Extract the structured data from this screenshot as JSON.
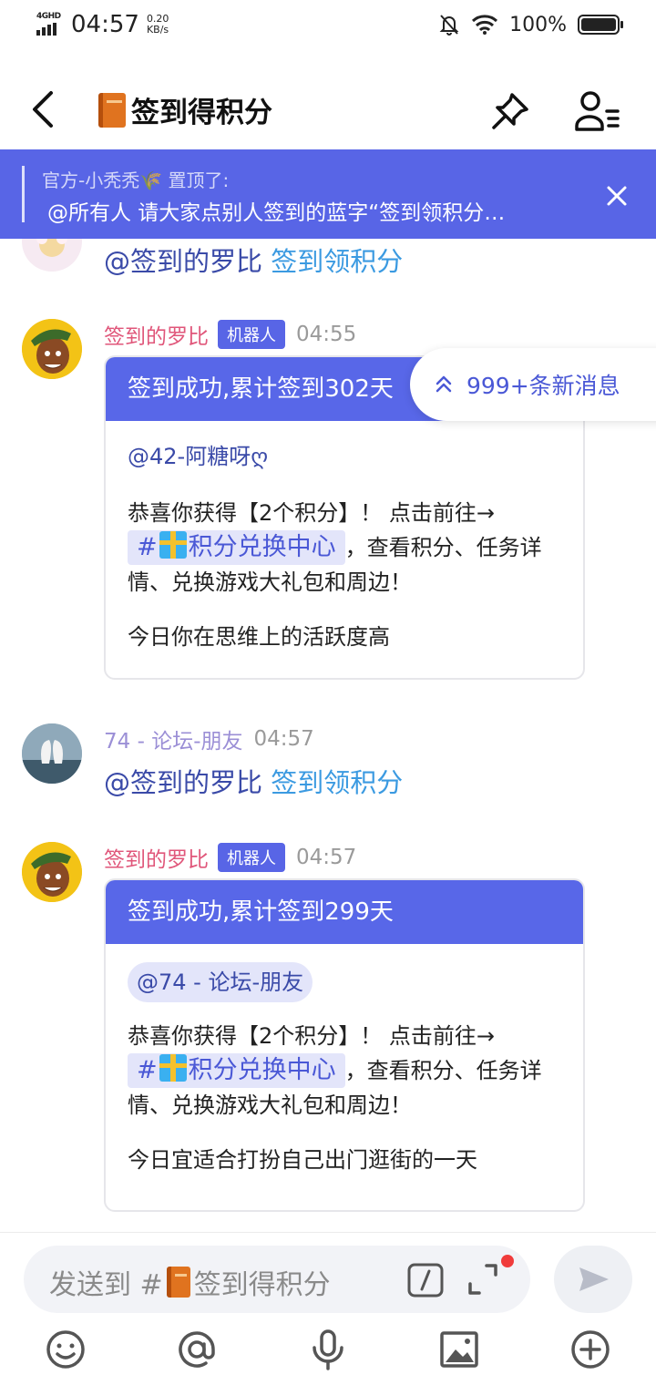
{
  "status_bar": {
    "network": "4GHD",
    "time": "04:57",
    "speed_value": "0.20",
    "speed_unit": "KB/s",
    "battery": "100%"
  },
  "header": {
    "title": "签到得积分"
  },
  "pinned": {
    "author_line": "官方-小秃秃🌾 置顶了:",
    "message": "@所有人 请大家点别人签到的蓝字“签到领积分…"
  },
  "messages": [
    {
      "type": "text",
      "mention": "@签到的罗比",
      "link": "签到领积分"
    },
    {
      "type": "bot_card",
      "sender": "签到的罗比",
      "badge": "机器人",
      "time": "04:55",
      "card_title": "签到成功,累计签到302天",
      "at_user": "@42-阿糖呀ღ",
      "body_pre": "恭喜你获得【2个积分】！ 点击前往→",
      "hash_prefix": "#",
      "hash_label": "积分兑换中心",
      "body_post": "，查看积分、任务详情、兑换游戏大礼包和周边！",
      "fortune": "今日你在思维上的活跃度高"
    },
    {
      "type": "text",
      "sender": "74 - 论坛-朋友",
      "time": "04:57",
      "mention": "@签到的罗比",
      "link": "签到领积分"
    },
    {
      "type": "bot_card",
      "sender": "签到的罗比",
      "badge": "机器人",
      "time": "04:57",
      "card_title": "签到成功,累计签到299天",
      "at_user": "@74 - 论坛-朋友",
      "body_pre": "恭喜你获得【2个积分】！ 点击前往→",
      "hash_prefix": "#",
      "hash_label": "积分兑换中心",
      "body_post": "，查看积分、任务详情、兑换游戏大礼包和周边！",
      "fortune": "今日宜适合打扮自己出门逛街的一天"
    }
  ],
  "new_messages_pill": "999+条新消息",
  "composer": {
    "placeholder_prefix": "发送到 #",
    "placeholder_channel": "签到得积分"
  },
  "colors": {
    "accent": "#5865e6",
    "bot_name": "#e0567a",
    "user_name": "#9b8fd6",
    "link": "#3b9ae1"
  },
  "icons": [
    "back-arrow-icon",
    "book-icon",
    "pin-icon",
    "member-list-icon",
    "close-icon",
    "double-chevron-up-icon",
    "slash-command-icon",
    "expand-icon",
    "send-icon",
    "emoji-icon",
    "at-icon",
    "microphone-icon",
    "image-icon",
    "plus-circle-icon"
  ]
}
